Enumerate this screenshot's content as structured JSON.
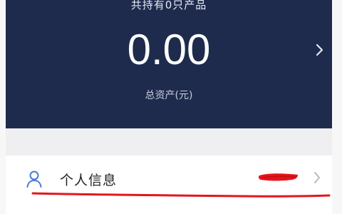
{
  "asset_card": {
    "holding_count_text": "共持有0只产品",
    "total_value": "0.00",
    "total_label": "总资产(元)",
    "arrow_icon": "chevron-right-icon",
    "background_color": "#1e2b4d"
  },
  "menu": {
    "personal_info": {
      "icon": "user-icon",
      "label": "个人信息",
      "chevron_icon": "chevron-right-icon"
    }
  },
  "annotations": {
    "redaction_color": "#e3161d",
    "underline_color": "#e3161d"
  }
}
